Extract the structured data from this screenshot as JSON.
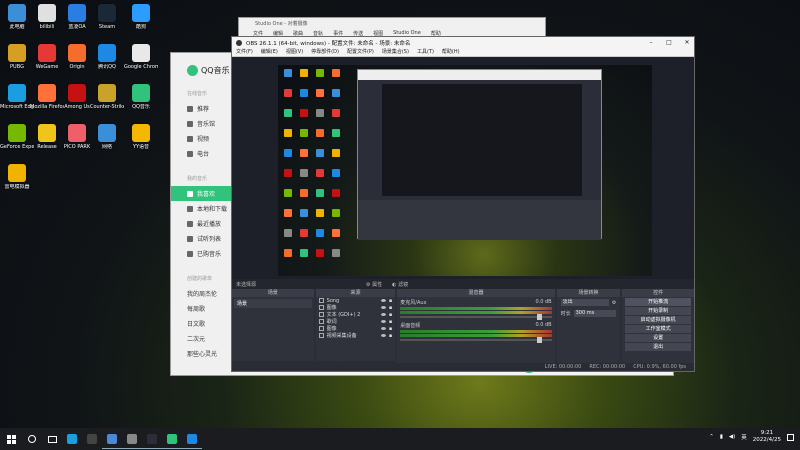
{
  "desktop": {
    "icons": [
      {
        "label": "此电脑",
        "color": "#3b8fd9"
      },
      {
        "label": "bilibili",
        "color": "#e0e0e0"
      },
      {
        "label": "蓝凌OA",
        "color": "#2a7de1"
      },
      {
        "label": "Steam",
        "color": "#1b2838"
      },
      {
        "label": "酷狗",
        "color": "#2c9cff"
      },
      {
        "label": "PUBG",
        "color": "#d5a021"
      },
      {
        "label": "WeGame",
        "color": "#e53935"
      },
      {
        "label": "Origin",
        "color": "#f56c2d"
      },
      {
        "label": "腾讯QQ",
        "color": "#1e88e5"
      },
      {
        "label": "Google Chrome",
        "color": "#e8e8e8"
      },
      {
        "label": "Microsoft Edge",
        "color": "#1b9de2"
      },
      {
        "label": "Mozilla Firefox",
        "color": "#ff7139"
      },
      {
        "label": "Among Us",
        "color": "#c51111"
      },
      {
        "label": "Counter-Strike",
        "color": "#c9a227"
      },
      {
        "label": "QQ音乐",
        "color": "#31c27c"
      },
      {
        "label": "GeForce Experience",
        "color": "#76b900"
      },
      {
        "label": "Release",
        "color": "#f0c419"
      },
      {
        "label": "PICO PARK",
        "color": "#ee5f6a"
      },
      {
        "label": "网络",
        "color": "#3b8fd9"
      },
      {
        "label": "YY语音",
        "color": "#f5b800"
      },
      {
        "label": "雷电模拟器",
        "color": "#f0b400"
      }
    ]
  },
  "studio_one": {
    "title": "Studio One - 对着摄像",
    "menu": [
      "文件",
      "编辑",
      "歌曲",
      "音轨",
      "事件",
      "传送",
      "视图",
      "Studio One",
      "帮助"
    ]
  },
  "qq_music": {
    "logo": "QQ音乐",
    "section_online": "在线音乐",
    "nav_online": [
      "推荐",
      "音乐馆",
      "视频",
      "电台"
    ],
    "section_mine": "我的音乐",
    "nav_mine": [
      "我喜欢",
      "本地和下载",
      "最近播放",
      "试听列表",
      "已购音乐"
    ],
    "section_created": "创建的歌单",
    "created": [
      "我的周杰伦",
      "每周歌",
      "日文歌",
      "二次元",
      "那些心灵光"
    ]
  },
  "obs": {
    "title": "OBS 26.1.1 (64-bit, windows) - 配置文件: 未命名 - 场景: 未命名",
    "menu": [
      "文件(F)",
      "编辑(E)",
      "视图(V)",
      "停靠部件(D)",
      "配置文件(P)",
      "场景集合(S)",
      "工具(T)",
      "帮助(H)"
    ],
    "no_source": "未选择源",
    "props_btn": "属性",
    "filter_btn": "滤镜",
    "docks": {
      "scenes": "场景",
      "sources": "来源",
      "mixer": "混音器",
      "transitions": "场景转换",
      "controls": "控件"
    },
    "scene_item": "场景",
    "sources": [
      "Song",
      "图像",
      "文本 (GDI+) 2",
      "歌词",
      "图像",
      "视频采集设备"
    ],
    "mixer": [
      {
        "name": "麦克风/Aux",
        "db": "0.0 dB"
      },
      {
        "name": "桌面音频",
        "db": "0.0 dB"
      }
    ],
    "transition_value": "淡出",
    "duration_label": "时长",
    "duration_value": "300 ms",
    "controls": [
      "开始推流",
      "开始录制",
      "启动虚拟摄像机",
      "工作室模式",
      "设置",
      "退出"
    ],
    "status": [
      "LIVE: 00:00:00",
      "REC: 00:00:00",
      "CPU: 0.9%, 60.00 fps"
    ]
  },
  "taskbar": {
    "time": "9:21",
    "date": "2022/4/25",
    "lang": "英",
    "apps": [
      "#1b9de2",
      "#444",
      "#4a88d8",
      "#888",
      "#2b2e38",
      "#31c27c",
      "#1e88e5"
    ]
  }
}
